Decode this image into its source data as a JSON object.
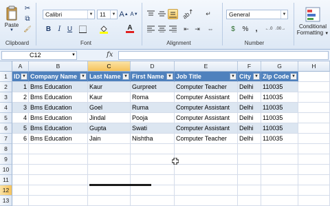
{
  "ribbon": {
    "clipboard": {
      "paste_label": "Paste",
      "group_label": "Clipboard"
    },
    "font": {
      "name": "Calibri",
      "size": "11",
      "group_label": "Font",
      "grow_label": "A",
      "shrink_label": "A",
      "bold_label": "B",
      "italic_label": "I",
      "underline_label": "U",
      "font_color_label": "A"
    },
    "alignment": {
      "group_label": "Alignment"
    },
    "number": {
      "format": "General",
      "currency_label": "$",
      "percent_label": "%",
      "comma_label": ",",
      "group_label": "Number"
    },
    "styles": {
      "conditional_label_1": "Conditional",
      "conditional_label_2": "Formatting"
    }
  },
  "formula_bar": {
    "name_box": "C12",
    "fx_label": "fx",
    "formula": ""
  },
  "sheet": {
    "columns": [
      "A",
      "B",
      "C",
      "D",
      "E",
      "F",
      "G",
      "H"
    ],
    "selected_column": "C",
    "rows": [
      "1",
      "2",
      "3",
      "4",
      "5",
      "6",
      "7",
      "8",
      "9",
      "10",
      "11",
      "12",
      "13"
    ],
    "selected_row": "12",
    "table": {
      "headers": [
        "ID",
        "Company Name",
        "Last Name",
        "First Name",
        "Job Title",
        "City",
        "Zip Code"
      ],
      "data": [
        [
          "1",
          "Bms Education",
          "Kaur",
          "Gurpreet",
          "Computer Teacher",
          "Delhi",
          "110035"
        ],
        [
          "2",
          "Bms Education",
          "Kaur",
          "Roma",
          "Computer Assistant",
          "Delhi",
          "110035"
        ],
        [
          "3",
          "Bms Education",
          "Goel",
          "Ruma",
          "Computer Assistant",
          "Delhi",
          "110035"
        ],
        [
          "4",
          "Bms Education",
          "Jindal",
          "Pooja",
          "Computer Assistant",
          "Delhi",
          "110035"
        ],
        [
          "5",
          "Bms Education",
          "Gupta",
          "Swati",
          "Computer Assistant",
          "Delhi",
          "110035"
        ],
        [
          "6",
          "Bms Education",
          "Jain",
          "Nishtha",
          "Computer Teacher",
          "Delhi",
          "110035"
        ]
      ]
    }
  },
  "colors": {
    "header_fill": "#4f81bd",
    "band_fill": "#dce6f1",
    "selection": "#f6c35c"
  }
}
